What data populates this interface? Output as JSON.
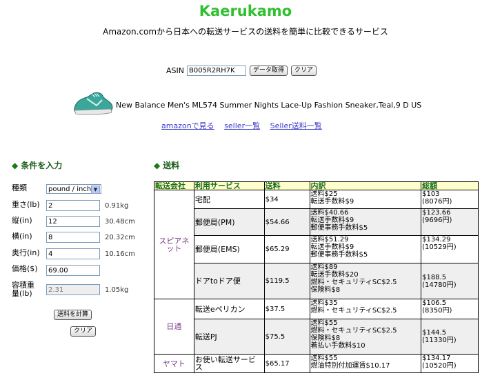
{
  "header": {
    "title": "Kaerukamo",
    "subtitle": "Amazon.comから日本への転送サービスの送料を簡単に比較できるサービス"
  },
  "asin": {
    "label": "ASIN",
    "value": "B005R2RH7K",
    "fetch_button": "データ取得",
    "clear_button": "クリア"
  },
  "product": {
    "name": "New Balance Men's ML574 Summer Nights Lace-Up Fashion Sneaker,Teal,9 D US",
    "image_icon": "teal-sneaker-image"
  },
  "links": {
    "amazon": "amazonで見る",
    "seller_list": "seller一覧",
    "seller_shipping": "Seller送料一覧"
  },
  "form": {
    "heading": "条件を入力",
    "type_label": "種類",
    "type_value": "pound / inch",
    "weight_label": "重さ(lb)",
    "weight_value": "2",
    "weight_conv": "0.91kg",
    "length_label": "縦(in)",
    "length_value": "12",
    "length_conv": "30.48cm",
    "width_label": "横(in)",
    "width_value": "8",
    "width_conv": "20.32cm",
    "depth_label": "奥行(in)",
    "depth_value": "4",
    "depth_conv": "10.16cm",
    "price_label": "価格($)",
    "price_value": "69.00",
    "volweight_label_1": "容積重",
    "volweight_label_2": "量(lb)",
    "volweight_value": "2.31",
    "volweight_conv": "1.05kg",
    "calc_button": "送料を計算",
    "clear_button": "クリア"
  },
  "shipping": {
    "heading": "送料",
    "columns": [
      "転送会社",
      "利用サービス",
      "送料",
      "内訳",
      "総額"
    ],
    "companies": {
      "spianet": "スピアネット",
      "nittsu": "日通",
      "yamato": "ヤマト"
    },
    "rows": [
      {
        "service": "宅配",
        "cost": "$34",
        "breakdown": [
          "送料$25",
          "転送手数料$9"
        ],
        "total": [
          "$103",
          "(8076円)"
        ]
      },
      {
        "service": "郵便局(PM)",
        "cost": "$54.66",
        "breakdown": [
          "送料$40.66",
          "転送手数料$9",
          "郵便事務手数料$5"
        ],
        "total": [
          "$123.66",
          "(9696円)"
        ]
      },
      {
        "service": "郵便局(EMS)",
        "cost": "$65.29",
        "breakdown": [
          "送料$51.29",
          "転送手数料$9",
          "郵便事務手数料$5"
        ],
        "total": [
          "$134.29",
          "(10529円)"
        ]
      },
      {
        "service": "ドアtoドア便",
        "cost": "$119.5",
        "breakdown": [
          "送料$89",
          "転送手数料$20",
          "燃料・セキュリティSC$2.5",
          "保険料$8"
        ],
        "total": [
          "$188.5",
          "(14780円)"
        ]
      },
      {
        "service": "転送eペリカン",
        "cost": "$37.5",
        "breakdown": [
          "送料$35",
          "燃料・セキュリティSC$2.5"
        ],
        "total": [
          "$106.5",
          "(8350円)"
        ]
      },
      {
        "service": "転送PJ",
        "cost": "$75.5",
        "breakdown": [
          "送料$55",
          "燃料・セキュリティSC$2.5",
          "保険料$8",
          "着払い手数料$10"
        ],
        "total": [
          "$144.5",
          "(11330円)"
        ]
      },
      {
        "service": "お使い転送サービス",
        "cost": "$65.17",
        "breakdown": [
          "送料$55",
          "燃油特別付加運賃$10.17"
        ],
        "total": [
          "$134.17",
          "(10520円)"
        ]
      }
    ]
  }
}
